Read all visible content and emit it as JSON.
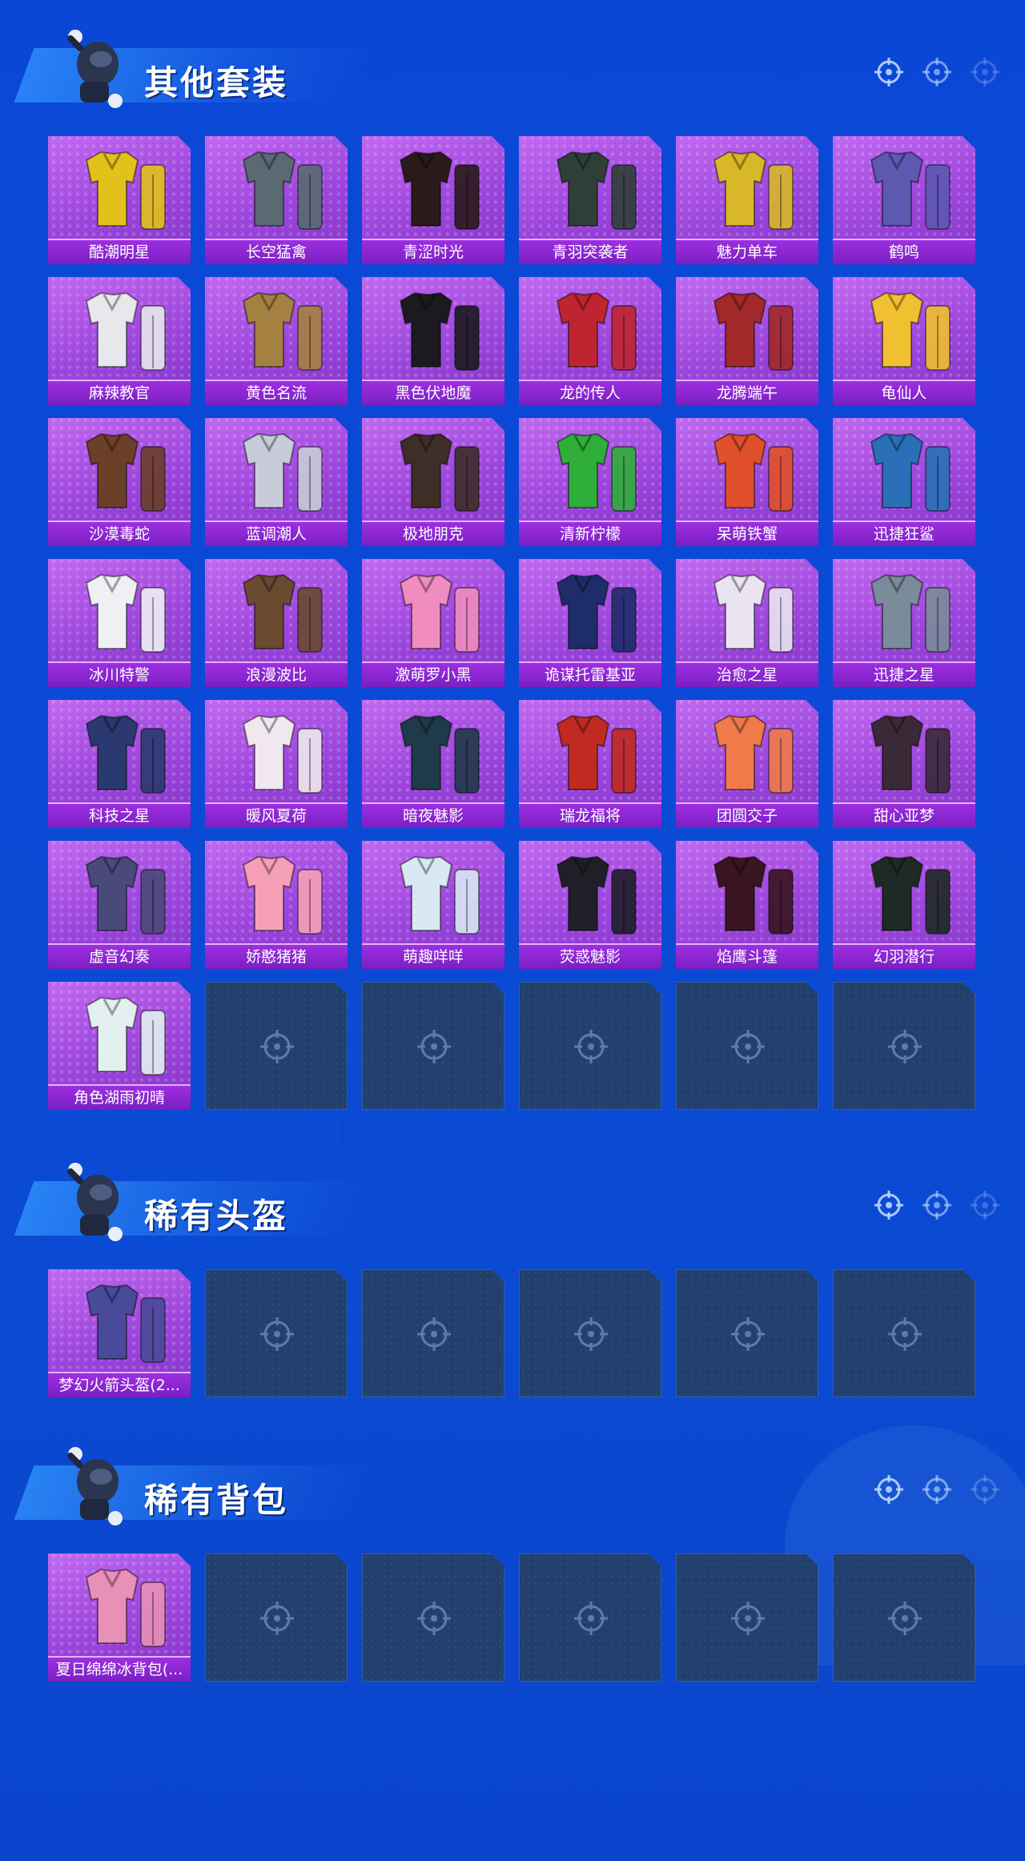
{
  "colors": {
    "background": "#0b47d6",
    "card_purple": "#a24ee2",
    "label_bar": "#8a27d0",
    "empty_slot": "#22406e",
    "title_text": "#ffffff"
  },
  "sections": [
    {
      "title": "其他套装",
      "icon": "soldier-mascot-icon",
      "items": [
        {
          "label": "酷潮明星",
          "color": "#e2c21a"
        },
        {
          "label": "长空猛禽",
          "color": "#5a6a72"
        },
        {
          "label": "青涩时光",
          "color": "#2a1a1a"
        },
        {
          "label": "青羽突袭者",
          "color": "#2f3f38"
        },
        {
          "label": "魅力单车",
          "color": "#d8b828"
        },
        {
          "label": "鹤鸣",
          "color": "#5d58b0"
        },
        {
          "label": "麻辣教官",
          "color": "#e8e8ec"
        },
        {
          "label": "黄色名流",
          "color": "#a48140"
        },
        {
          "label": "黑色伏地魔",
          "color": "#1b1b1f"
        },
        {
          "label": "龙的传人",
          "color": "#c02430"
        },
        {
          "label": "龙腾端午",
          "color": "#a3282a"
        },
        {
          "label": "龟仙人",
          "color": "#f0c030"
        },
        {
          "label": "沙漠毒蛇",
          "color": "#6a4028"
        },
        {
          "label": "蓝调潮人",
          "color": "#c8ccd8"
        },
        {
          "label": "极地朋克",
          "color": "#3e2e28"
        },
        {
          "label": "清新柠檬",
          "color": "#2fae3a"
        },
        {
          "label": "呆萌铁蟹",
          "color": "#e0502a"
        },
        {
          "label": "迅捷狂鲨",
          "color": "#2a70b8"
        },
        {
          "label": "冰川特警",
          "color": "#f0f0f4"
        },
        {
          "label": "浪漫波比",
          "color": "#6a4a30"
        },
        {
          "label": "激萌罗小黑",
          "color": "#f08cc0"
        },
        {
          "label": "诡谋托雷基亚",
          "color": "#1f2c6a"
        },
        {
          "label": "治愈之星",
          "color": "#eae4f0"
        },
        {
          "label": "迅捷之星",
          "color": "#7a8c9a"
        },
        {
          "label": "科技之星",
          "color": "#2a3a70"
        },
        {
          "label": "暖风夏荷",
          "color": "#f0e8ee"
        },
        {
          "label": "暗夜魅影",
          "color": "#1f3a4a"
        },
        {
          "label": "瑞龙福将",
          "color": "#c02a20"
        },
        {
          "label": "团圆交子",
          "color": "#f07a4a"
        },
        {
          "label": "甜心亚梦",
          "color": "#3a2a38"
        },
        {
          "label": "虚音幻奏",
          "color": "#4a4a7a"
        },
        {
          "label": "娇憨猪猪",
          "color": "#f5a0b8"
        },
        {
          "label": "萌趣咩咩",
          "color": "#d8e8f4"
        },
        {
          "label": "荧惑魅影",
          "color": "#1f1f28"
        },
        {
          "label": "焰鹰斗篷",
          "color": "#3a1420"
        },
        {
          "label": "幻羽潜行",
          "color": "#1f2a24"
        },
        {
          "label": "角色湖雨初晴",
          "color": "#e4f0f0"
        }
      ],
      "empty_slots": 5
    },
    {
      "title": "稀有头盔",
      "icon": "soldier-mascot-icon",
      "items": [
        {
          "label": "梦幻火箭头盔(2...",
          "color": "#4a4a9a"
        }
      ],
      "empty_slots": 5
    },
    {
      "title": "稀有背包",
      "icon": "soldier-mascot-icon",
      "items": [
        {
          "label": "夏日绵绵冰背包(...",
          "color": "#e890b8"
        }
      ],
      "empty_slots": 5
    }
  ]
}
